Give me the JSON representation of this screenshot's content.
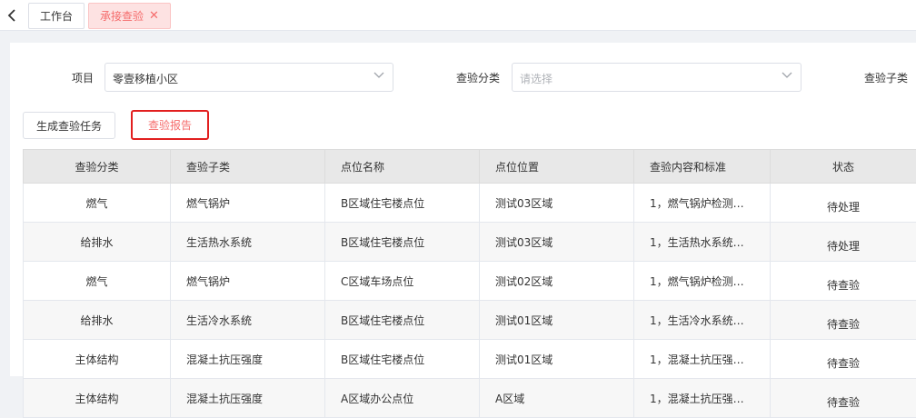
{
  "tabs": [
    {
      "label": "工作台"
    },
    {
      "label": "承接查验"
    }
  ],
  "filters": {
    "project_label": "项目",
    "project_value": "零壹移植小区",
    "category_label": "查验分类",
    "category_placeholder": "请选择",
    "subcategory_label": "查验子类"
  },
  "actions": {
    "generate_label": "生成查验任务",
    "report_label": "查验报告"
  },
  "table": {
    "columns": [
      "查验分类",
      "查验子类",
      "点位名称",
      "点位位置",
      "查验内容和标准",
      "状态"
    ],
    "rows": [
      [
        "燃气",
        "燃气锅炉",
        "B区域住宅楼点位",
        "测试03区域",
        "1，燃气锅炉检测…",
        "待处理"
      ],
      [
        "给排水",
        "生活热水系统",
        "B区域住宅楼点位",
        "测试03区域",
        "1，生活热水系统…",
        "待处理"
      ],
      [
        "燃气",
        "燃气锅炉",
        "C区域车场点位",
        "测试02区域",
        "1，燃气锅炉检测…",
        "待查验"
      ],
      [
        "给排水",
        "生活冷水系统",
        "B区域住宅楼点位",
        "测试01区域",
        "1，生活冷水系统…",
        "待查验"
      ],
      [
        "主体结构",
        "混凝土抗压强度",
        "B区域住宅楼点位",
        "测试01区域",
        "1，混凝土抗压强…",
        "待查验"
      ],
      [
        "主体结构",
        "混凝土抗压强度",
        "A区域办公点位",
        "A区域",
        "1，混凝土抗压强…",
        "待查验"
      ]
    ]
  },
  "icons": {
    "back": "chevron-left-icon",
    "close": "close-icon",
    "dropdown": "chevron-down-icon"
  },
  "colors": {
    "active_tab_bg": "#fde2e2",
    "active_tab_text": "#f56c6c",
    "highlight_border": "#e21f1f",
    "header_bg": "#e8e8e8"
  }
}
